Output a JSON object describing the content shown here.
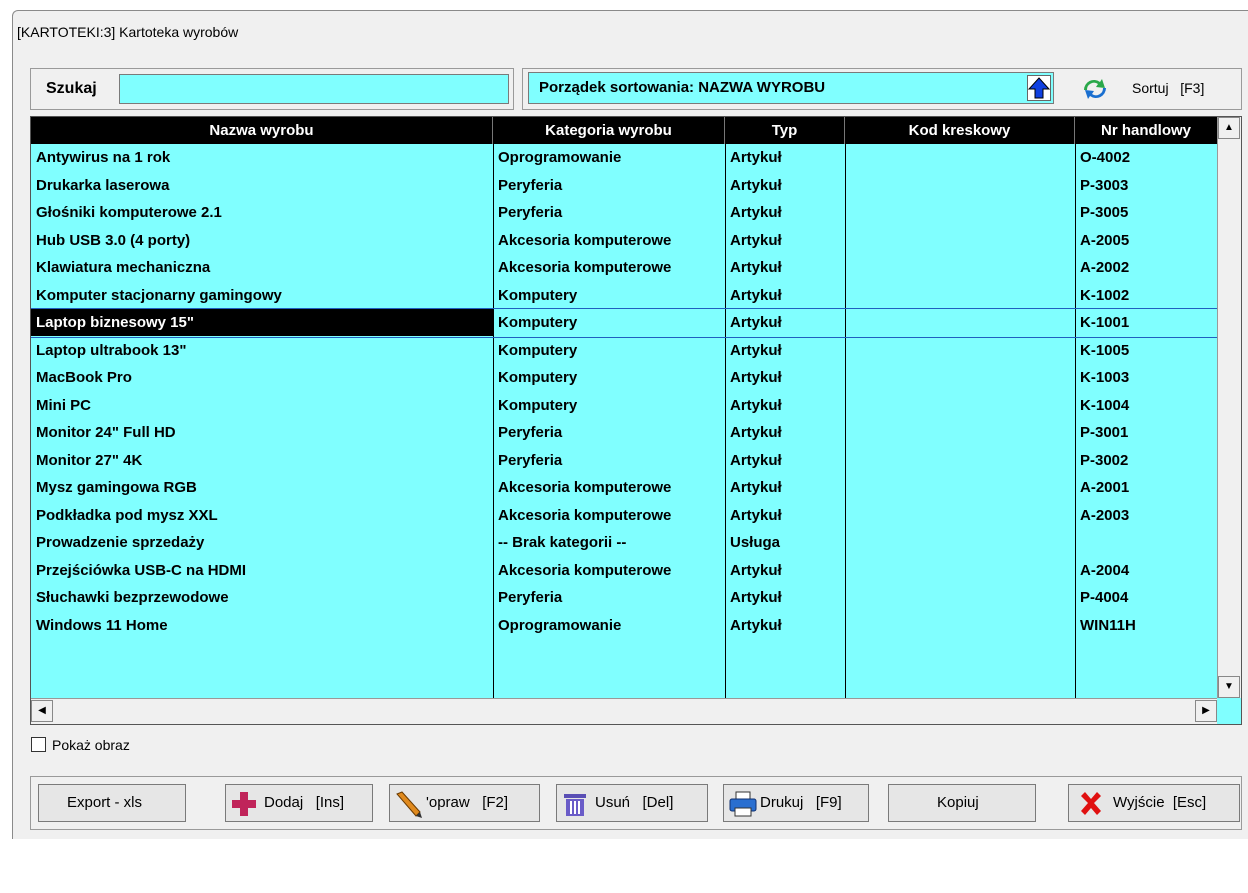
{
  "window": {
    "title": "[KARTOTEKI:3]  Kartoteka wyrobów"
  },
  "search": {
    "label": "Szukaj",
    "value": ""
  },
  "sort": {
    "order_text": "Porządek sortowania: NAZWA WYROBU",
    "button_label": "Sortuj   [F3]"
  },
  "table": {
    "columns": [
      "Nazwa wyrobu",
      "Kategoria wyrobu",
      "Typ",
      "Kod kreskowy",
      "Nr handlowy"
    ],
    "rows": [
      [
        "Antywirus na 1 rok",
        "Oprogramowanie",
        "Artykuł",
        "",
        "O-4002"
      ],
      [
        "Drukarka laserowa",
        "Peryferia",
        "Artykuł",
        "",
        "P-3003"
      ],
      [
        "Głośniki komputerowe 2.1",
        "Peryferia",
        "Artykuł",
        "",
        "P-3005"
      ],
      [
        "Hub USB 3.0 (4 porty)",
        "Akcesoria komputerowe",
        "Artykuł",
        "",
        "A-2005"
      ],
      [
        "Klawiatura mechaniczna",
        "Akcesoria komputerowe",
        "Artykuł",
        "",
        "A-2002"
      ],
      [
        "Komputer stacjonarny gamingowy",
        "Komputery",
        "Artykuł",
        "",
        "K-1002"
      ],
      [
        "Laptop biznesowy 15\"",
        "Komputery",
        "Artykuł",
        "",
        "K-1001"
      ],
      [
        "Laptop ultrabook 13\"",
        "Komputery",
        "Artykuł",
        "",
        "K-1005"
      ],
      [
        "MacBook Pro",
        "Komputery",
        "Artykuł",
        "",
        "K-1003"
      ],
      [
        "Mini PC",
        "Komputery",
        "Artykuł",
        "",
        "K-1004"
      ],
      [
        "Monitor 24\" Full HD",
        "Peryferia",
        "Artykuł",
        "",
        "P-3001"
      ],
      [
        "Monitor 27\" 4K",
        "Peryferia",
        "Artykuł",
        "",
        "P-3002"
      ],
      [
        "Mysz gamingowa RGB",
        "Akcesoria komputerowe",
        "Artykuł",
        "",
        "A-2001"
      ],
      [
        "Podkładka pod mysz XXL",
        "Akcesoria komputerowe",
        "Artykuł",
        "",
        "A-2003"
      ],
      [
        "Prowadzenie sprzedaży",
        " -- Brak kategorii --",
        "Usługa",
        "",
        ""
      ],
      [
        "Przejściówka USB-C na HDMI",
        "Akcesoria komputerowe",
        "Artykuł",
        "",
        "A-2004"
      ],
      [
        "Słuchawki bezprzewodowe",
        "Peryferia",
        "Artykuł",
        "",
        "P-4004"
      ],
      [
        "Windows 11 Home",
        "Oprogramowanie",
        "Artykuł",
        "",
        "WIN11H"
      ]
    ],
    "selected_row": 6
  },
  "show_image": {
    "label": "Pokaż obraz",
    "checked": false
  },
  "buttons": {
    "export": "Export - xls",
    "add": "Dodaj   [Ins]",
    "edit": "'opraw   [F2]",
    "delete": "Usuń   [Del]",
    "print": "Drukuj   [F9]",
    "copy": "Kopiuj",
    "exit": "Wyjście  [Esc]"
  },
  "colors": {
    "grid_bg": "#80ffff",
    "header_bg": "#000000",
    "selected_bg": "#000000"
  }
}
